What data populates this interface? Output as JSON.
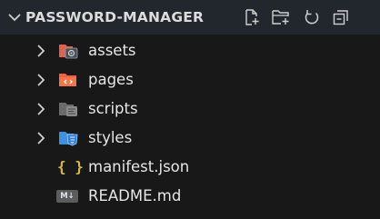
{
  "explorer": {
    "title": "PASSWORD-MANAGER",
    "actions": [
      {
        "name": "new-file",
        "icon": "new-file-icon"
      },
      {
        "name": "new-folder",
        "icon": "new-folder-icon"
      },
      {
        "name": "refresh",
        "icon": "refresh-icon"
      },
      {
        "name": "collapse-all",
        "icon": "collapse-all-icon"
      }
    ],
    "items": [
      {
        "type": "folder",
        "label": "assets",
        "expanded": false,
        "icon": "folder-assets-icon",
        "icon_color": "#e0614c"
      },
      {
        "type": "folder",
        "label": "pages",
        "expanded": false,
        "icon": "folder-pages-icon",
        "icon_color": "#f0603a"
      },
      {
        "type": "folder",
        "label": "scripts",
        "expanded": false,
        "icon": "folder-scripts-icon",
        "icon_color": "#777777"
      },
      {
        "type": "folder",
        "label": "styles",
        "expanded": false,
        "icon": "folder-styles-icon",
        "icon_color": "#3d8fe0"
      },
      {
        "type": "file",
        "label": "manifest.json",
        "icon": "json-icon",
        "icon_text": "{ }",
        "icon_color": "#d7ba45"
      },
      {
        "type": "file",
        "label": "README.md",
        "icon": "markdown-icon",
        "icon_text": "M↓",
        "icon_color": "#5c5c5c"
      }
    ]
  },
  "colors": {
    "background": "#181818",
    "header_background": "#22272e",
    "text": "#e6e6e6"
  }
}
